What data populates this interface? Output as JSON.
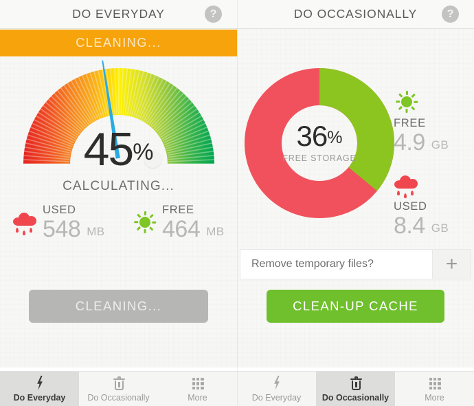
{
  "left_panel": {
    "header": {
      "title": "DO EVERYDAY",
      "help_icon": "help-icon",
      "help_glyph": "?"
    },
    "banner": {
      "text": "CLEANING..."
    },
    "gauge": {
      "percent_value": "45",
      "percent_unit": "%",
      "status": "CALCULATING...",
      "needle_angle_deg": 27,
      "needle_color": "#29ABE2",
      "track_colors": [
        "#E52421",
        "#EF4E23",
        "#F6871F",
        "#FBB316",
        "#FFF100",
        "#C5D92D",
        "#8DC63F",
        "#38B449",
        "#00A651"
      ]
    },
    "stats": [
      {
        "icon": "rain-cloud-icon",
        "label": "USED",
        "value": "548",
        "unit": "MB",
        "color": "#F0464E"
      },
      {
        "icon": "sun-icon",
        "label": "FREE",
        "value": "464",
        "unit": "MB",
        "color": "#7DC623"
      }
    ],
    "action_button": {
      "label": "CLEANING...",
      "color": "#B6B6B4",
      "disabled": true
    },
    "tabs": [
      {
        "icon": "lightning-bolt-icon",
        "label": "Do Everyday",
        "active": true
      },
      {
        "icon": "trash-icon",
        "label": "Do Occasionally",
        "active": false
      },
      {
        "icon": "dots-grid-icon",
        "label": "More",
        "active": false
      }
    ]
  },
  "right_panel": {
    "header": {
      "title": "DO OCCASIONALLY",
      "help_icon": "help-icon",
      "help_glyph": "?"
    },
    "donut": {
      "percent_value": "36",
      "percent_unit": "%",
      "caption": "FREE STORAGE",
      "free_color": "#8CC520",
      "used_color": "#F0515C"
    },
    "legend": [
      {
        "icon": "sun-icon",
        "label": "FREE",
        "value": "4.9",
        "unit": "GB",
        "color": "#7DC623"
      },
      {
        "icon": "rain-cloud-icon",
        "label": "USED",
        "value": "8.4",
        "unit": "GB",
        "color": "#F0464E"
      }
    ],
    "temp_files_row": {
      "text": "Remove temporary files?",
      "plus_glyph": "+"
    },
    "action_button": {
      "label": "CLEAN-UP CACHE",
      "color": "#6FC02C",
      "disabled": false
    },
    "tabs": [
      {
        "icon": "lightning-bolt-icon",
        "label": "Do Everyday",
        "active": false
      },
      {
        "icon": "trash-icon",
        "label": "Do Occasionally",
        "active": true
      },
      {
        "icon": "dots-grid-icon",
        "label": "More",
        "active": false
      }
    ]
  },
  "chart_data": [
    {
      "type": "gauge",
      "title": "Memory usage gauge",
      "value": 45,
      "unit": "%",
      "min": 0,
      "max": 100,
      "status_label": "CALCULATING...",
      "needle_value": 45,
      "series": [
        {
          "name": "USED",
          "value": 548,
          "unit": "MB"
        },
        {
          "name": "FREE",
          "value": 464,
          "unit": "MB"
        }
      ],
      "color_scale": [
        "#E52421",
        "#F6871F",
        "#FFF100",
        "#8DC63F",
        "#00A651"
      ]
    },
    {
      "type": "pie",
      "title": "Storage breakdown",
      "center_label": "36%",
      "center_sublabel": "FREE STORAGE",
      "categories": [
        "FREE",
        "USED"
      ],
      "values": [
        4.9,
        8.4
      ],
      "percentages": [
        36,
        64
      ],
      "unit": "GB",
      "colors": [
        "#8CC520",
        "#F0515C"
      ],
      "legend_position": "right",
      "donut": true
    }
  ]
}
